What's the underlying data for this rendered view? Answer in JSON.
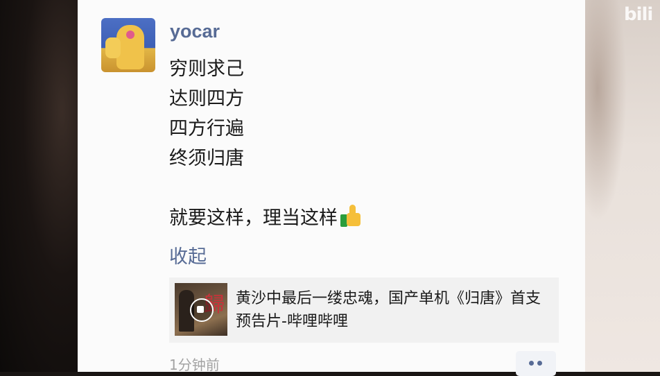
{
  "watermark": "bili",
  "post": {
    "username": "yocar",
    "lines": [
      "穷则求己",
      "达则四方",
      "四方行遍",
      "终须归唐"
    ],
    "closing_line": "就要这样，理当这样",
    "closing_emoji": "thumbs-up-icon",
    "collapse_label": "收起",
    "shared_link": {
      "title": "黄沙中最后一缕忠魂，国产单机《归唐》首支预告片-哔哩哔哩",
      "cover_glyph": "歸"
    },
    "time": "1分钟前"
  },
  "colors": {
    "link_blue": "#576b95",
    "card_bg": "#fbfbfb",
    "share_bg": "#f1f1f1",
    "time_gray": "#a3a3a3"
  }
}
